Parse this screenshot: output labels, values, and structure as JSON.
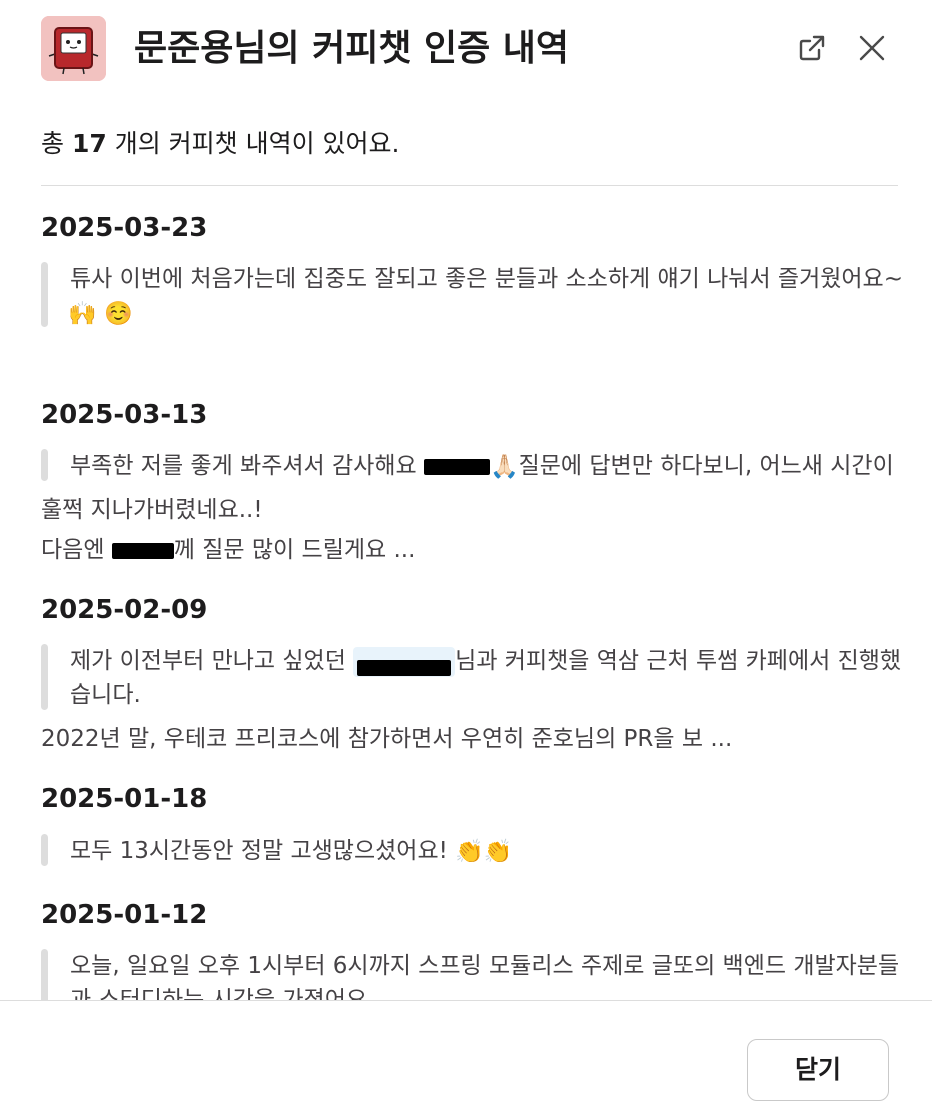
{
  "header": {
    "title": "문준용님의 커피챗 인증 내역",
    "avatar_icon": "robot-app-icon",
    "external_icon": "open-external-icon",
    "close_icon": "close-icon"
  },
  "summary": {
    "prefix": "총 ",
    "count": "17",
    "suffix": " 개의 커피챗 내역이 있어요."
  },
  "entries": [
    {
      "date": "2025-03-23",
      "quote_lines": [
        "튜사 이번에 처음가는데 집중도 잘되고 좋은 분들과 소소하게 얘기 나눠서 즐거웠어요~"
      ],
      "emojis": [
        "🙌",
        "☺️"
      ]
    },
    {
      "date": "2025-03-13",
      "quote_a": "부족한 저를 좋게 봐주셔서 감사해요 ",
      "quote_emoji": "🙏🏻",
      "quote_b": "질문에 답변만 하다보니, 어느새 시간이",
      "line2": "훌쩍 지나가버렸네요..!",
      "line3_b": "께 질문 많이 드릴게요  ...",
      "line3_a": "다음엔 "
    },
    {
      "date": "2025-02-09",
      "quote_a": "제가 이전부터 만나고 싶었던 ",
      "quote_b": "님과 커피챗을 역삼 근처 투썸 카페에서 진행했",
      "quote_line2": "습니다.",
      "line3": "2022년 말, 우테코 프리코스에 참가하면서 우연히 준호님의 PR을 보 ..."
    },
    {
      "date": "2025-01-18",
      "quote": "모두 13시간동안 정말 고생많으셨어요! ",
      "emojis": [
        "👏",
        "👏"
      ]
    },
    {
      "date": "2025-01-12",
      "quote_line1": "오늘, 일요일 오후 1시부터 6시까지 스프링 모듈리스 주제로 글또의 백엔드 개발자분들",
      "quote_line2": "과 스터디하는 시간을 가졌어요."
    }
  ],
  "footer": {
    "close_label": "닫기"
  }
}
